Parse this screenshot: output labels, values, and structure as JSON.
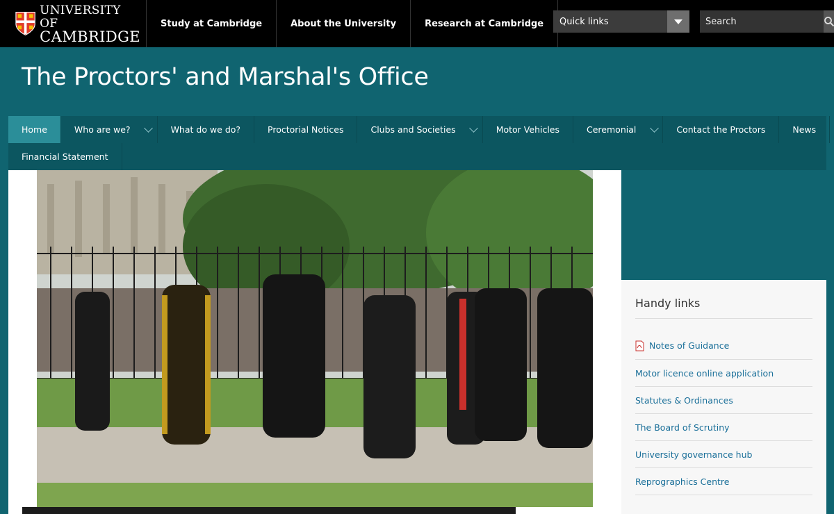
{
  "header": {
    "logo_line1": "UNIVERSITY OF",
    "logo_line2": "CAMBRIDGE",
    "nav": [
      "Study at Cambridge",
      "About the University",
      "Research at Cambridge"
    ],
    "quicklinks_label": "Quick links",
    "search_placeholder": "Search"
  },
  "site": {
    "title": "The Proctors' and Marshal's Office"
  },
  "mainnav": {
    "row1": [
      {
        "label": "Home",
        "active": true,
        "dropdown": false
      },
      {
        "label": "Who are we?",
        "active": false,
        "dropdown": true
      },
      {
        "label": "What do we do?",
        "active": false,
        "dropdown": false
      },
      {
        "label": "Proctorial Notices",
        "active": false,
        "dropdown": false
      },
      {
        "label": "Clubs and Societies",
        "active": false,
        "dropdown": true
      },
      {
        "label": "Motor Vehicles",
        "active": false,
        "dropdown": false
      },
      {
        "label": "Ceremonial",
        "active": false,
        "dropdown": true
      },
      {
        "label": "Contact the Proctors",
        "active": false,
        "dropdown": false
      },
      {
        "label": "News",
        "active": false,
        "dropdown": false
      }
    ],
    "row2": [
      {
        "label": "Financial Statement",
        "active": false,
        "dropdown": false
      }
    ]
  },
  "sidebar": {
    "title": "Handy links",
    "links": [
      {
        "label": "Notes of Guidance",
        "icon": "pdf-icon"
      },
      {
        "label": "Motor licence online application",
        "icon": ""
      },
      {
        "label": "Statutes & Ordinances",
        "icon": ""
      },
      {
        "label": "The Board of Scrutiny",
        "icon": ""
      },
      {
        "label": "University governance hub",
        "icon": ""
      },
      {
        "label": "Reprographics Centre",
        "icon": ""
      }
    ]
  },
  "colors": {
    "brand_teal": "#106470",
    "nav_teal": "#0c5660",
    "active_tab": "#2b8e99",
    "link_blue": "#1a6f99"
  }
}
